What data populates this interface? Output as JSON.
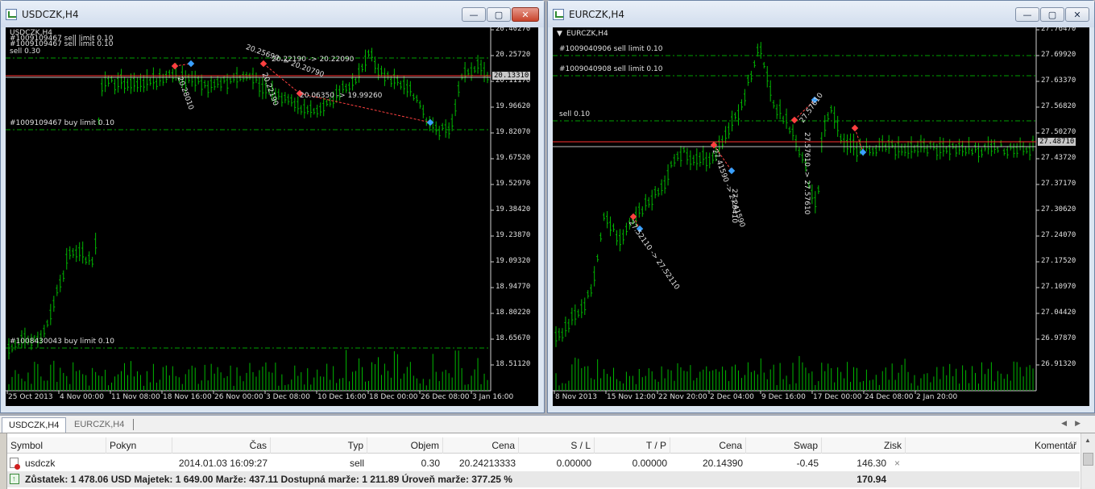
{
  "colors": {
    "candle": "#00b800",
    "grid": "#00a000",
    "bid_line": "#ff3030",
    "ask_line": "#c0c0c0",
    "trade_line": "#ff4040",
    "chart_bg": "#000000"
  },
  "windows": [
    {
      "title": "USDCZK,H4",
      "yticks": [
        "20.40270",
        "20.25720",
        "20.11170",
        "19.96620",
        "19.82070",
        "19.67520",
        "19.52970",
        "19.38420",
        "19.23870",
        "19.09320",
        "18.94770",
        "18.80220",
        "18.65670",
        "18.51120"
      ],
      "xticks": [
        "25 Oct 2013",
        "4 Nov 00:00",
        "11 Nov 08:00",
        "18 Nov 16:00",
        "26 Nov 00:00",
        "3 Dec 08:00",
        "10 Dec 16:00",
        "18 Dec 00:00",
        "26 Dec 08:00",
        "3 Jan 16:00"
      ],
      "bid_price": "20.13310",
      "order_labels": [
        "#1009109467 buy limit 0.10",
        "#1008430043 buy limit 0.10",
        "sell 0.30"
      ],
      "top_overlay": [
        "USDCZK,H4",
        "#1009109467 sell limit 0.10",
        "#1009109467 sell limit 0.10"
      ],
      "trade_texts": [
        "20.22190 -> 20.22090",
        "20.06350 -> 19.99260",
        "20.25690 -> 20.20790",
        "20.28010",
        "20.22190"
      ]
    },
    {
      "title": "EURCZK,H4",
      "inner_title": "EURCZK,H4",
      "yticks": [
        "27.76470",
        "27.69920",
        "27.63370",
        "27.56820",
        "27.50270",
        "27.43720",
        "27.37170",
        "27.30620",
        "27.24070",
        "27.17520",
        "27.10970",
        "27.04420",
        "26.97870",
        "26.91320"
      ],
      "xticks": [
        "8 Nov 2013",
        "15 Nov 12:00",
        "22 Nov 20:00",
        "2 Dec 04:00",
        "9 Dec 16:00",
        "17 Dec 00:00",
        "24 Dec 08:00",
        "2 Jan 20:00"
      ],
      "bid_price": "27.48710",
      "order_labels": [
        "#1009040906 sell limit 0.10",
        "#1009040908 sell limit 0.10",
        "sell 0.10"
      ],
      "trade_texts": [
        "27.52110 -> 27.52110",
        "27.41590 -> 27.41590",
        "27.26410",
        "27.57610",
        "27.57610 -> 27.57610"
      ]
    }
  ],
  "tabs": [
    "USDCZK,H4",
    "EURCZK,H4"
  ],
  "terminal": {
    "headers": [
      "Symbol",
      "Pokyn",
      "Čas",
      "Typ",
      "Objem",
      "Cena",
      "S / L",
      "T / P",
      "Cena",
      "Swap",
      "Zisk",
      "Komentář"
    ],
    "row": {
      "symbol": "usdczk",
      "time": "2014.01.03 16:09:27",
      "type": "sell",
      "volume": "0.30",
      "open_price": "20.24213333",
      "sl": "0.00000",
      "tp": "0.00000",
      "price": "20.14390",
      "swap": "-0.45",
      "profit": "146.30"
    },
    "summary": {
      "text": "Zůstatek: 1 478.06 USD  Majetek: 1 649.00  Marže: 437.11  Dostupná marže: 1 211.89  Úroveň marže: 377.25 %",
      "profit": "170.94"
    },
    "close_glyph": "×"
  },
  "icons": [
    "chart-window-icon",
    "minimize-icon",
    "maximize-icon",
    "close-icon",
    "position-icon",
    "balance-icon",
    "scroll-left-icon",
    "scroll-right-icon"
  ]
}
